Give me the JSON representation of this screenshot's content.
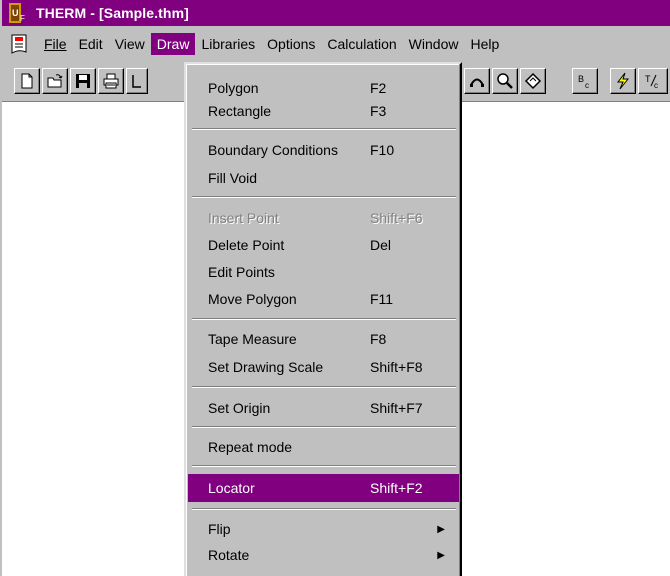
{
  "window": {
    "title": "THERM - [Sample.thm]"
  },
  "menubar": {
    "items": [
      {
        "label": "File"
      },
      {
        "label": "Edit"
      },
      {
        "label": "View"
      },
      {
        "label": "Draw"
      },
      {
        "label": "Libraries"
      },
      {
        "label": "Options"
      },
      {
        "label": "Calculation"
      },
      {
        "label": "Window"
      },
      {
        "label": "Help"
      }
    ],
    "open_menu": "Draw"
  },
  "toolbar": {
    "left_buttons": [
      "new-file-icon",
      "open-folder-icon",
      "save-disk-icon",
      "print-icon"
    ],
    "right_buttons": [
      "arc-icon",
      "zoom-magnifier-icon",
      "rotate-diamond-icon",
      "boundary-condition-icon",
      "calculate-lightning-icon",
      "temperature-icon"
    ]
  },
  "draw_menu": {
    "items": [
      {
        "label": "Polygon",
        "shortcut": "F2"
      },
      {
        "label": "Rectangle",
        "shortcut": "F3"
      },
      {
        "label": "Boundary Conditions",
        "shortcut": "F10"
      },
      {
        "label": "Fill Void",
        "shortcut": ""
      },
      {
        "label": "Insert Point",
        "shortcut": "Shift+F6",
        "disabled": true
      },
      {
        "label": "Delete Point",
        "shortcut": "Del"
      },
      {
        "label": "Edit Points",
        "shortcut": ""
      },
      {
        "label": "Move Polygon",
        "shortcut": "F11"
      },
      {
        "label": "Tape Measure",
        "shortcut": "F8"
      },
      {
        "label": "Set Drawing Scale",
        "shortcut": "Shift+F8"
      },
      {
        "label": "Set Origin",
        "shortcut": "Shift+F7"
      },
      {
        "label": "Repeat mode",
        "shortcut": ""
      },
      {
        "label": "Locator",
        "shortcut": "Shift+F2",
        "highlighted": true
      },
      {
        "label": "Flip",
        "shortcut": "",
        "submenu": true
      },
      {
        "label": "Rotate",
        "shortcut": "",
        "submenu": true
      }
    ]
  },
  "colors": {
    "title_bar": "#800080",
    "menu_face": "#c0c0c0",
    "highlight": "#800080",
    "workspace": "#ffffff"
  }
}
